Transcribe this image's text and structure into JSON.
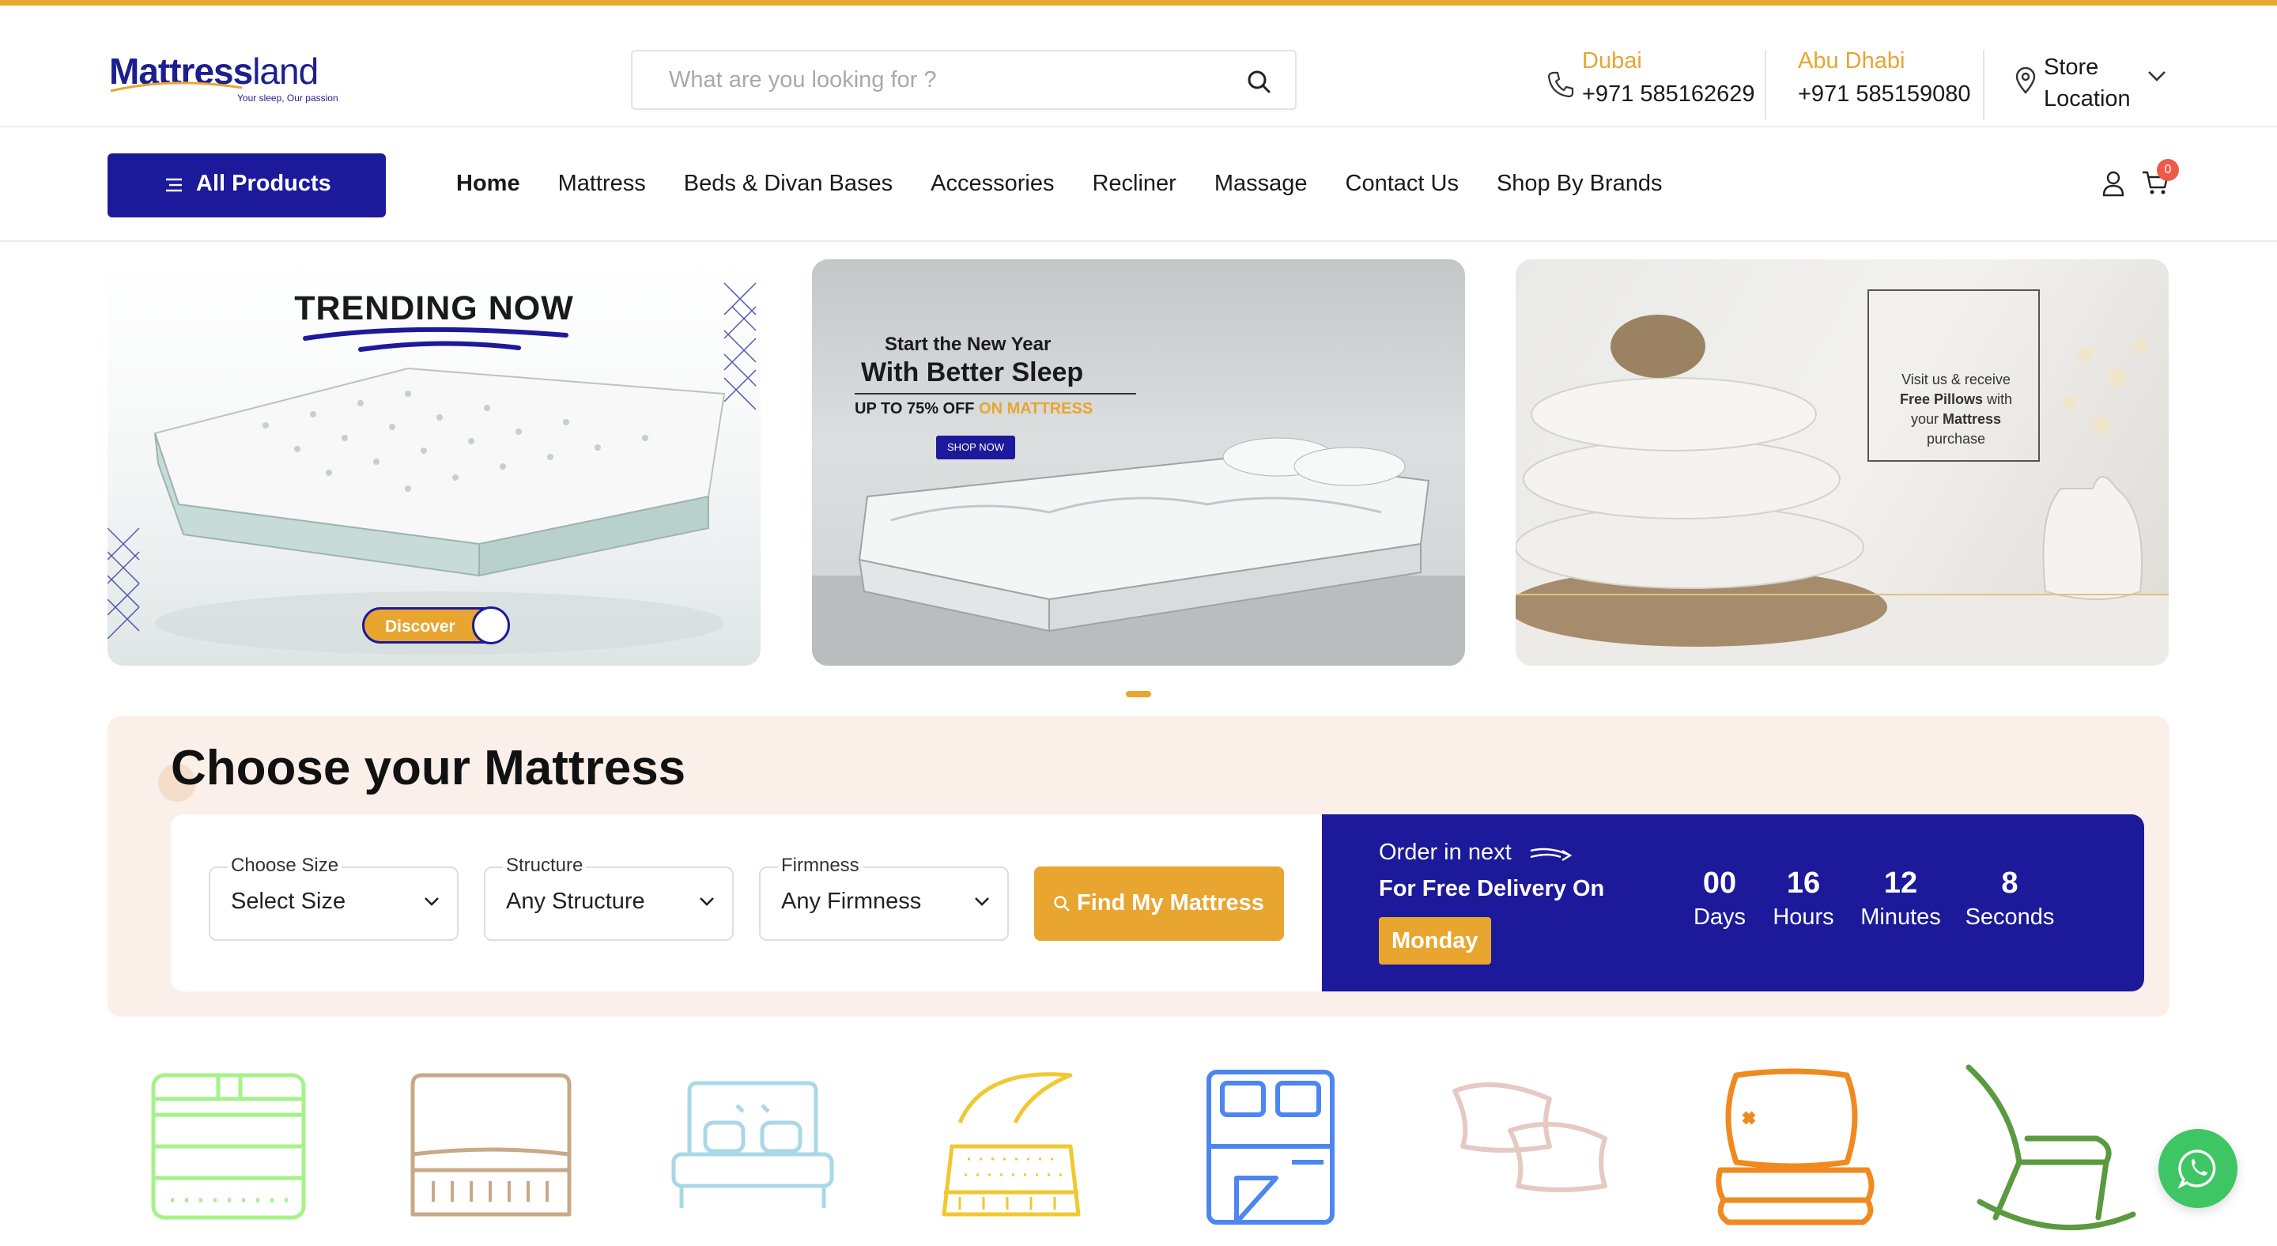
{
  "header": {
    "logo_main": "Mattress",
    "logo_thin": "land",
    "logo_tagline": "Your sleep, Our passion",
    "search_placeholder": "What are you looking for ?",
    "contacts": [
      {
        "city": "Dubai",
        "phone": "+971 585162629"
      },
      {
        "city": "Abu Dhabi",
        "phone": "+971 585159080"
      }
    ],
    "store_label_1": "Store",
    "store_label_2": "Location"
  },
  "nav": {
    "all_products": "All Products",
    "items": [
      "Home",
      "Mattress",
      "Beds & Divan Bases",
      "Accessories",
      "Recliner",
      "Massage",
      "Contact Us",
      "Shop By Brands"
    ],
    "active": "Home",
    "cart_count": "0"
  },
  "banners": {
    "b1_title": "TRENDING NOW",
    "b1_button": "Discover",
    "b2_line1": "Start the New Year",
    "b2_line2": "With Better Sleep",
    "b2_line3_a": "UP TO 75% OFF ",
    "b2_line3_b": "ON MATTRESS",
    "b2_button": "SHOP NOW",
    "b3_l1": "Visit us & receive",
    "b3_l2_bold": "Free Pillows",
    "b3_l2_rest": " with",
    "b3_l3_a": "your ",
    "b3_l3_bold": "Mattress",
    "b3_l4": "purchase"
  },
  "choose": {
    "title": "Choose your Mattress",
    "fields": [
      {
        "label": "Choose Size",
        "value": "Select Size"
      },
      {
        "label": "Structure",
        "value": "Any Structure"
      },
      {
        "label": "Firmness",
        "value": "Any Firmness"
      }
    ],
    "find_button": "Find My Mattress",
    "order_line": "Order in next",
    "delivery_line": "For Free Delivery On",
    "delivery_day": "Monday",
    "countdown": [
      {
        "value": "00",
        "unit": "Days"
      },
      {
        "value": "16",
        "unit": "Hours"
      },
      {
        "value": "12",
        "unit": "Minutes"
      },
      {
        "value": "8",
        "unit": "Seconds"
      }
    ]
  },
  "colors": {
    "accent": "#e8a530",
    "brand": "#1c1a9a",
    "choose_bg": "#fbefe9",
    "whatsapp": "#3ec664"
  },
  "categories": [
    "bed-icon",
    "mattress-icon",
    "headboard-bed-icon",
    "topper-icon",
    "bed-sheet-icon",
    "pillows-icon",
    "cushion-icon",
    "rocking-chair-icon"
  ]
}
